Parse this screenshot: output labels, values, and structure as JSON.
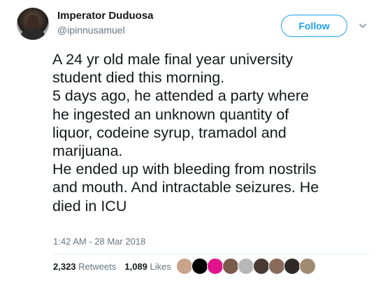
{
  "author": {
    "display_name": "Imperator Duduosa",
    "handle": "@ipinnusamuel",
    "avatar_icon": "user-avatar-icon"
  },
  "follow_button": {
    "label": "Follow",
    "color": "#1da1f2"
  },
  "menu_caret_icon": "chevron-down-icon",
  "tweet": {
    "lines": [
      "A 24 yr old male final year university",
      "student died this morning.",
      "5 days ago, he attended a party where",
      "he ingested an unknown quantity of",
      "liquor, codeine syrup, tramadol and",
      "marijuana.",
      "He ended up with bleeding from nostrils",
      "and mouth. And intractable seizures. He",
      "died in ICU"
    ],
    "timestamp": "1:42 AM - 28 Mar 2018"
  },
  "stats": {
    "retweets_count": "2,323",
    "retweets_label": "Retweets",
    "likes_count": "1,089",
    "likes_label": "Likes"
  },
  "likers": [
    "#c9a48a",
    "#000000",
    "#e0128c",
    "#7a5b4a",
    "#b7b7b7",
    "#4a3a36",
    "#8a6a5a",
    "#2f2a28",
    "#a08a70"
  ]
}
